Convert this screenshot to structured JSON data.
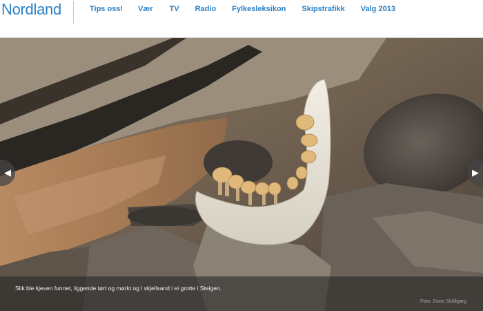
{
  "header": {
    "brand": "Nordland",
    "nav": [
      "Tips oss!",
      "Vær",
      "TV",
      "Radio",
      "Fylkesleksikon",
      "Skipstrafikk",
      "Valg 2013"
    ]
  },
  "slideshow": {
    "caption": "Slik ble kjeven funnet, liggende tørt og mørkt og i skjellsand i ei grotte i Steigen.",
    "credit": "Foto: Svein Skålbjørg",
    "prev_icon": "◀",
    "next_icon": "▶"
  },
  "colors": {
    "brand": "#2a7fc4",
    "caption_bg": "#282828"
  },
  "icons": {
    "prev": "arrow-left-icon",
    "next": "arrow-right-icon"
  }
}
